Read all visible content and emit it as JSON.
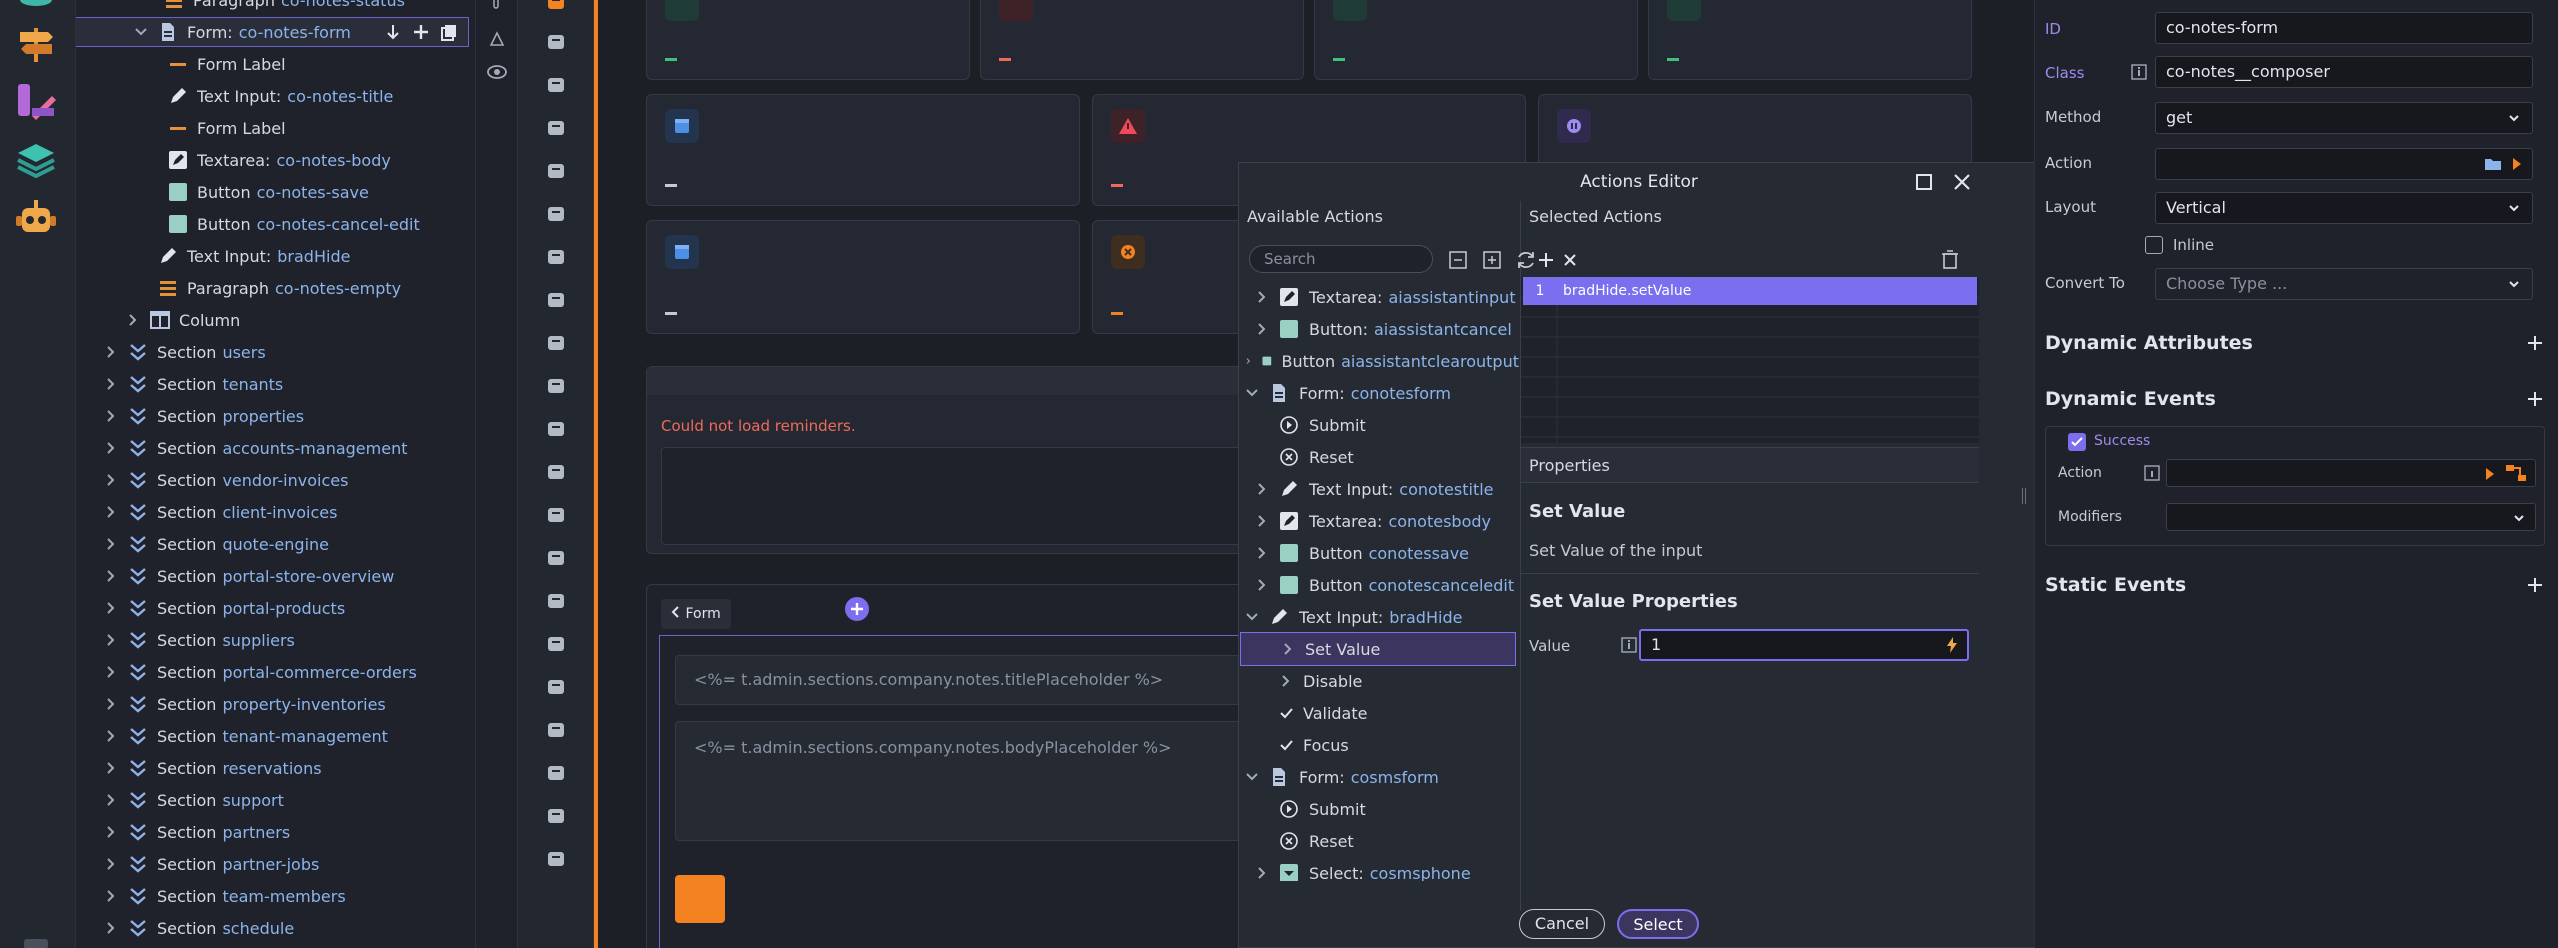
{
  "tree": {
    "paragraph_top": {
      "label": "Paragraph",
      "name": "co-notes-status"
    },
    "form_row": {
      "label": "Form:",
      "name": "co-notes-form"
    },
    "form_children": [
      {
        "kind": "label",
        "label": "Form Label",
        "name": ""
      },
      {
        "kind": "text",
        "label": "Text Input:",
        "name": "co-notes-title"
      },
      {
        "kind": "label",
        "label": "Form Label",
        "name": ""
      },
      {
        "kind": "textarea",
        "label": "Textarea:",
        "name": "co-notes-body"
      },
      {
        "kind": "button",
        "label": "Button",
        "name": "co-notes-save"
      },
      {
        "kind": "button",
        "label": "Button",
        "name": "co-notes-cancel-edit"
      }
    ],
    "text_brad": {
      "label": "Text Input:",
      "name": "bradHide"
    },
    "paragraph_empty": {
      "label": "Paragraph",
      "name": "co-notes-empty"
    },
    "column_label": "Column",
    "section_label": "Section",
    "sections": [
      "users",
      "tenants",
      "properties",
      "accounts-management",
      "vendor-invoices",
      "client-invoices",
      "quote-engine",
      "portal-store-overview",
      "portal-products",
      "suppliers",
      "portal-commerce-orders",
      "property-inventories",
      "tenant-management",
      "reservations",
      "support",
      "partners",
      "partner-jobs",
      "team-members",
      "schedule"
    ]
  },
  "canvas": {
    "error_text": "Could not load reminders.",
    "form_tag": "Form",
    "title_placeholder": "<%= t.admin.sections.company.notes.titlePlaceholder %>",
    "body_placeholder": "<%= t.admin.sections.company.notes.bodyPlaceholder %>",
    "dash": "–"
  },
  "modal": {
    "title": "Actions Editor",
    "available_header": "Available Actions",
    "selected_header": "Selected Actions",
    "search_placeholder": "Search",
    "available": [
      {
        "indent": 1,
        "expand": "right",
        "kind": "textarea",
        "label": "Textarea:",
        "name": "aiassistantinput"
      },
      {
        "indent": 1,
        "expand": "right",
        "kind": "button",
        "label": "Button:",
        "name": "aiassistantcancel"
      },
      {
        "indent": 0,
        "expand": "right",
        "kind": "button",
        "label": "Button",
        "name": "aiassistantclearoutput"
      },
      {
        "indent": 0,
        "expand": "down",
        "kind": "form",
        "label": "Form:",
        "name": "conotesform"
      },
      {
        "indent": 2,
        "expand": "none",
        "kind": "submit",
        "label": "Submit",
        "name": ""
      },
      {
        "indent": 2,
        "expand": "none",
        "kind": "reset",
        "label": "Reset",
        "name": ""
      },
      {
        "indent": 1,
        "expand": "right",
        "kind": "text",
        "label": "Text Input:",
        "name": "conotestitle"
      },
      {
        "indent": 1,
        "expand": "right",
        "kind": "textarea",
        "label": "Textarea:",
        "name": "conotesbody"
      },
      {
        "indent": 1,
        "expand": "right",
        "kind": "button",
        "label": "Button",
        "name": "conotessave"
      },
      {
        "indent": 1,
        "expand": "right",
        "kind": "button",
        "label": "Button",
        "name": "conotescanceledit"
      },
      {
        "indent": 0,
        "expand": "down",
        "kind": "text",
        "label": "Text Input:",
        "name": "bradHide"
      },
      {
        "indent": 2,
        "expand": "right",
        "kind": "none",
        "label": "Set Value",
        "name": "",
        "selected": true
      },
      {
        "indent": 2,
        "expand": "right",
        "kind": "none",
        "label": "Disable",
        "name": ""
      },
      {
        "indent": 2,
        "expand": "check",
        "kind": "none",
        "label": "Validate",
        "name": ""
      },
      {
        "indent": 2,
        "expand": "check",
        "kind": "none",
        "label": "Focus",
        "name": ""
      },
      {
        "indent": 0,
        "expand": "down",
        "kind": "form",
        "label": "Form:",
        "name": "cosmsform"
      },
      {
        "indent": 2,
        "expand": "none",
        "kind": "submit",
        "label": "Submit",
        "name": ""
      },
      {
        "indent": 2,
        "expand": "none",
        "kind": "reset",
        "label": "Reset",
        "name": ""
      },
      {
        "indent": 1,
        "expand": "right",
        "kind": "select",
        "label": "Select:",
        "name": "cosmsphone"
      }
    ],
    "selected_row": {
      "index": "1",
      "label": "bradHide.setValue"
    },
    "properties_header": "Properties",
    "prop_title": "Set Value",
    "prop_desc": "Set Value of the input",
    "prop_sub": "Set Value Properties",
    "value_label": "Value",
    "value": "1",
    "cancel": "Cancel",
    "select": "Select"
  },
  "panel": {
    "id_label": "ID",
    "id_value": "co-notes-form",
    "class_label": "Class",
    "class_value": "co-notes__composer",
    "method_label": "Method",
    "method_value": "get",
    "action_label": "Action",
    "layout_label": "Layout",
    "layout_value": "Vertical",
    "inline_label": "Inline",
    "convert_label": "Convert To",
    "convert_placeholder": "Choose Type ...",
    "dyn_attr": "Dynamic Attributes",
    "dyn_events": "Dynamic Events",
    "success_label": "Success",
    "event_action_label": "Action",
    "modifiers_label": "Modifiers",
    "static_events": "Static Events"
  },
  "colors": {
    "accent": "#7b6ff0",
    "orange": "#f58220",
    "tree_name": "#8cb4ea",
    "error": "#ef6a5a",
    "selected_bg": "#7b6ff0"
  }
}
